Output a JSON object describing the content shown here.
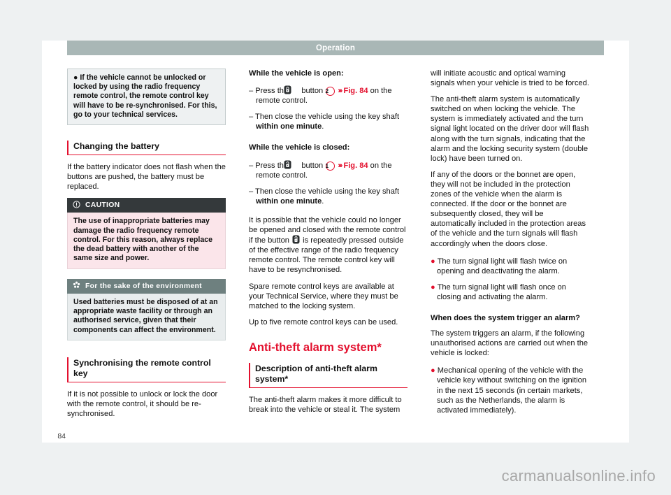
{
  "header": {
    "running_head": "Operation"
  },
  "folio": {
    "page_number": "84"
  },
  "watermark": {
    "text": "carmanualsonline.info"
  },
  "icons": {
    "caution": "warning-circle-icon",
    "environment": "flower-environment-icon",
    "key_lock": "key-lock-button-icon",
    "key_unlock": "key-unlock-button-icon"
  },
  "colors": {
    "accent_red": "#e3102e",
    "running_head_bg": "#a9b7b6",
    "caution_header_bg": "#34393b",
    "caution_body_bg": "#fbe5ea",
    "environment_header_bg": "#6e807f",
    "environment_body_bg": "#e9edee",
    "note_bg": "#eef1f2"
  },
  "column1": {
    "note": {
      "bullet": "●",
      "text": "If the vehicle cannot be unlocked or locked by using the radio frequency remote control, the remote control key will have to be re-synchronised. For this, go to your technical services."
    },
    "heading_changing_battery": "Changing the battery",
    "para_battery": "If the battery indicator does not flash when the buttons are pushed, the battery must be replaced.",
    "caution": {
      "title": "CAUTION",
      "text": "The use of inappropriate batteries may damage the radio frequency remote control. For this reason, always replace the dead battery with another of the same size and power."
    },
    "environment": {
      "title": "For the sake of the environment",
      "text": "Used batteries must be disposed of at an appropriate waste facility or through an authorised service, given that their components can affect the environment."
    },
    "heading_synchronising": "Synchronising the remote control key",
    "para_synchronising": "If it is not possible to unlock or lock the door with the remote control, it should be re-synchronised."
  },
  "column2": {
    "heading_open": "While the vehicle is open:",
    "open_step1": {
      "pre": "– Press the",
      "mid": "button",
      "number": "2",
      "chev": "›››",
      "xref": "Fig. 84",
      "post": "on the remote control."
    },
    "open_step2": {
      "pre": "– Then close the vehicle using the key shaft",
      "bold": "within one minute",
      "post": "."
    },
    "heading_closed": "While the vehicle is closed:",
    "closed_step1": {
      "pre": "– Press the",
      "mid": "button",
      "number": "1",
      "chev": "›››",
      "xref": "Fig. 84",
      "post": "on the remote control."
    },
    "closed_step2": {
      "pre": "– Then close the vehicle using the key shaft",
      "bold": "within one minute",
      "post": "."
    },
    "para_repeated_press_a": "It is possible that the vehicle could no longer be opened and closed with the remote control if the button",
    "para_repeated_press_b": "is repeatedly pressed outside of the effective range of the radio frequency remote control. The remote control key will have to be resynchronised.",
    "para_spare_keys": "Spare remote control keys are available at your Technical Service, where they must be matched to the locking system.",
    "para_five_keys": "Up to five remote control keys can be used.",
    "heading_antitheft": "Anti-theft alarm system*",
    "heading_description": "Description of anti-theft alarm system*",
    "para_description": "The anti-theft alarm makes it more difficult to break into the vehicle or steal it. The system"
  },
  "column3": {
    "para_continued": "will initiate acoustic and optical warning signals when your vehicle is tried to be forced.",
    "para_auto_on": "The anti-theft alarm system is automatically switched on when locking the vehicle. The system is immediately activated and the turn signal light located on the driver door will flash along with the turn signals, indicating that the alarm and the locking security system (double lock) have been turned on.",
    "para_doors_bonnet": "If any of the doors or the bonnet are open, they will not be included in the protection zones of the vehicle when the alarm is connected. If the door or the bonnet are subsequently closed, they will be automatically included in the protection areas of the vehicle and the turn signals will flash accordingly when the doors close.",
    "bullets": [
      "The turn signal light will flash twice on opening and deactivating the alarm.",
      "The turn signal light will flash once on closing and activating the alarm."
    ],
    "heading_trigger": "When does the system trigger an alarm?",
    "para_trigger": "The system triggers an alarm, if the following unauthorised actions are carried out when the vehicle is locked:",
    "trigger_bullets": [
      "Mechanical opening of the vehicle with the vehicle key without switching on the ignition in the next 15 seconds (in certain markets, such as the Netherlands, the alarm is activated immediately)."
    ],
    "bullet_char": "●"
  }
}
